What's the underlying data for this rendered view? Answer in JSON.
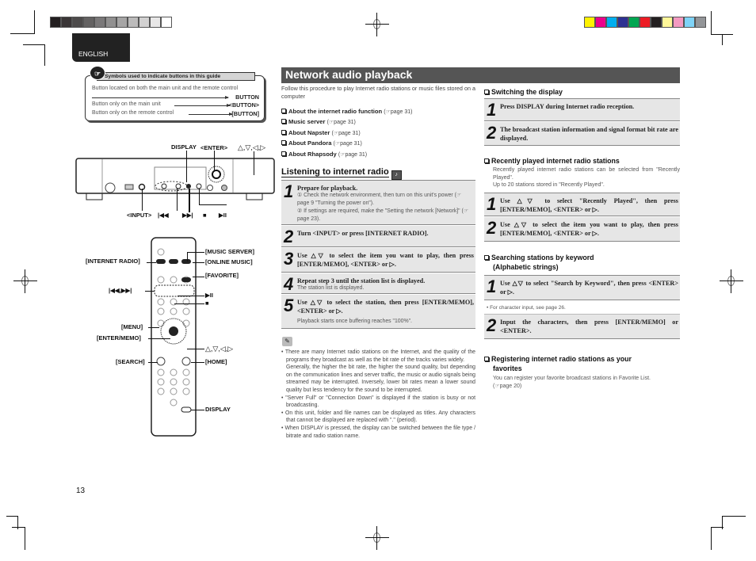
{
  "print_marks": {
    "gray_swatches": [
      "#231f20",
      "#3a3637",
      "#4d4b4b",
      "#646262",
      "#7a7879",
      "#919090",
      "#a6a5a5",
      "#bcbbbb",
      "#d2d1d1",
      "#e8e7e7",
      "#ffffff"
    ],
    "color_swatches": [
      "#fff200",
      "#ec008c",
      "#00aeef",
      "#2e3192",
      "#00a651",
      "#ed1c24",
      "#231f20",
      "#fff799",
      "#f49ac1",
      "#7fd3f7",
      "#939598"
    ]
  },
  "language_tab": "ENGLISH",
  "symbols_box": {
    "title": "Symbols used to indicate buttons in this guide",
    "icon": "pointing-hand-icon",
    "rows": [
      {
        "text": "Button located on both the main unit and the remote control",
        "keyword": ""
      },
      {
        "text": "",
        "keyword": "BUTTON"
      },
      {
        "text": "Button only on the main unit",
        "keyword": "<BUTTON>"
      },
      {
        "text": "Button only on the remote control",
        "keyword": "[BUTTON]"
      }
    ]
  },
  "main_unit_labels": {
    "display": "DISPLAY",
    "enter": "<ENTER>",
    "arrows": "△,▽,◁,▷",
    "input": "<INPUT>",
    "prev": "|◀◀",
    "next": "▶▶|",
    "stop": "■",
    "play_pause": "▶II"
  },
  "remote_labels": {
    "internet_radio": "[INTERNET RADIO]",
    "music_server": "[MUSIC SERVER]",
    "online_music": "[ONLINE MUSIC]",
    "favorite": "[FAVORITE]",
    "skip": "|◀◀,▶▶|",
    "play_pause": "▶II",
    "stop": "■",
    "menu": "[MENU]",
    "enter_memo": "[ENTER/MEMO]",
    "arrows": "△,▽,◁,▷",
    "search": "[SEARCH]",
    "home": "[HOME]",
    "display": "DISPLAY"
  },
  "main": {
    "title": "Network audio playback",
    "intro": "Follow this procedure to play Internet radio stations or music files stored on a computer",
    "links": [
      {
        "label": "About the internet radio function",
        "ref": "page 31"
      },
      {
        "label": "Music server",
        "ref": "page 31"
      },
      {
        "label": "About Napster",
        "ref": "page 31"
      },
      {
        "label": "About Pandora",
        "ref": "page 31"
      },
      {
        "label": "About Rhapsody",
        "ref": "page 31"
      }
    ],
    "listening_heading": "Listening to internet radio",
    "steps": [
      {
        "num": "1",
        "text": "Prepare for playback.",
        "sub": [
          "① Check the network environment, then turn on this unit's power (☞page 9 \"Turning the power on\").",
          "② If settings are required, make the \"Setting the network [Network]\" (☞page 23)."
        ]
      },
      {
        "num": "2",
        "text": "Turn <INPUT> or press [INTERNET RADIO].",
        "sub": []
      },
      {
        "num": "3",
        "text": "Use △▽ to select the item you want to play, then press [ENTER/MEMO], <ENTER> or ▷.",
        "sub": []
      },
      {
        "num": "4",
        "text": "Repeat step 3 until the station list is displayed.",
        "sub": [
          "The station list is displayed."
        ]
      },
      {
        "num": "5",
        "text": "Use △▽ to select the station, then press [ENTER/MEMO], <ENTER> or ▷.",
        "sub": [
          "Playback starts once buffering reaches \"100%\"."
        ]
      }
    ],
    "notes": [
      "There are many Internet radio stations on the Internet, and the quality of the programs they broadcast as well as the bit rate of the tracks varies widely.",
      "Generally, the higher the bit rate, the higher the sound quality, but depending on the communication lines and server traffic, the music or audio signals being streamed may be interrupted. Inversely, lower bit rates mean a lower sound quality but less tendency for the sound to be interrupted.",
      "\"Server Full\" or \"Connection Down\" is displayed if the station is busy or not broadcasting.",
      "On this unit, folder and file names can be displayed as titles. Any characters that cannot be displayed are replaced with \".\" (period).",
      "When DISPLAY is pressed, the display can be switched between the file type / bitrate and radio station name."
    ]
  },
  "right": {
    "switching": {
      "heading": "Switching the display",
      "steps": [
        {
          "num": "1",
          "text": "Press DISPLAY during Internet radio reception."
        },
        {
          "num": "2",
          "text": "The broadcast station information and signal format bit rate are displayed."
        }
      ]
    },
    "recent": {
      "heading": "Recently played internet radio stations",
      "body1": "Recently played internet radio stations can be selected from \"Recently Played\".",
      "body2": "Up to 20 stations stored in \"Recently Played\".",
      "steps": [
        {
          "num": "1",
          "text": "Use △▽ to select \"Recently Played\", then press [ENTER/MEMO], <ENTER> or ▷."
        },
        {
          "num": "2",
          "text": "Use △▽ to select the item you want to play, then press [ENTER/MEMO], <ENTER> or ▷."
        }
      ]
    },
    "search": {
      "heading1": "Searching stations by keyword",
      "heading2": "(Alphabetic strings)",
      "steps": [
        {
          "num": "1",
          "text": "Use △▽ to select \"Search by Keyword\", then press <ENTER> or ▷."
        },
        {
          "num": "2",
          "text": "Input the characters, then press [ENTER/MEMO] or <ENTER>."
        }
      ],
      "note": "• For character input, see page 26."
    },
    "favorites": {
      "heading1": "Registering internet radio stations as your",
      "heading2": "favorites",
      "body": "You can register your favorite broadcast stations in Favorite List.",
      "ref": "(☞page 20)"
    }
  },
  "page_number": "13"
}
